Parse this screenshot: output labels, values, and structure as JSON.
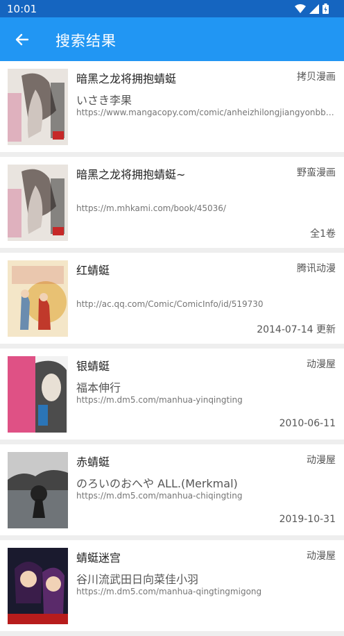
{
  "status": {
    "time": "10:01"
  },
  "header": {
    "title": "搜索结果",
    "back_icon": "arrow-left-icon"
  },
  "results": [
    {
      "title": "暗黑之龙将拥抱蜻蜓",
      "source": "拷贝漫画",
      "author": "いさき李果",
      "url": "https://www.mangacopy.com/comic/anheizhilongjiangyonbbaoqingting",
      "meta": ""
    },
    {
      "title": "暗黑之龙将拥抱蜻蜓~",
      "source": "野蛮漫画",
      "author": "",
      "url": "https://m.mhkami.com/book/45036/",
      "meta": "全1卷"
    },
    {
      "title": "红蜻蜓",
      "source": "腾讯动漫",
      "author": "",
      "url": "http://ac.qq.com/Comic/ComicInfo/id/519730",
      "meta": "2014-07-14 更新"
    },
    {
      "title": "银蜻蜓",
      "source": "动漫屋",
      "author": "福本伸行",
      "url": "https://m.dm5.com/manhua-yinqingting",
      "meta": "2010-06-11"
    },
    {
      "title": "赤蜻蜓",
      "source": "动漫屋",
      "author": "のろいのおへや  ALL.(Merkmal)",
      "url": "https://m.dm5.com/manhua-chiqingting",
      "meta": "2019-10-31"
    },
    {
      "title": "蜻蜓迷宫",
      "source": "动漫屋",
      "author": "谷川流武田日向菜佳小羽",
      "url": "https://m.dm5.com/manhua-qingtingmigong",
      "meta": ""
    }
  ]
}
